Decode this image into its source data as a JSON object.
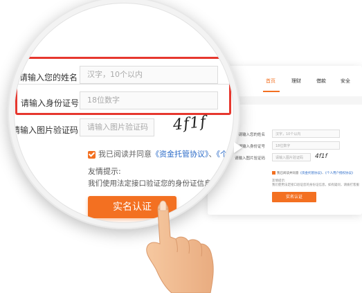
{
  "background_page": {
    "nav": [
      {
        "label": "首页",
        "active": true
      },
      {
        "label": "理财",
        "active": false
      },
      {
        "label": "借款",
        "active": false
      },
      {
        "label": "安全",
        "active": false
      }
    ],
    "form": {
      "name_label": "请输入您的姓名",
      "name_placeholder": "汉字，10个以内",
      "id_label": "请输入身份证号",
      "id_placeholder": "18位数字",
      "captcha_label": "请输入图片验证码",
      "captcha_placeholder": "请输入图片验证码",
      "captcha_text": "4f1f"
    },
    "agree_prefix": "我已阅读并同意",
    "agree_link1": "《资金托管协议》",
    "agree_mid": "、",
    "agree_link2": "《个人用户授权协议》",
    "tip_title": "友情提示:",
    "tip_text": "我们使用法定接口验证您的身份证信息，如有疑问，请拨打客服",
    "submit_label": "实名认证"
  },
  "magnifier": {
    "name_label": "请输入您的姓名",
    "name_placeholder": "汉字，10个以内",
    "id_label": "请输入身份证号",
    "id_placeholder": "18位数字",
    "captcha_label": "请输入图片验证码",
    "captcha_placeholder": "请输入图片验证码",
    "captcha_text": "4f1f",
    "agree_prefix": "我已阅读并同意",
    "agree_link1": "《资金托管协议》",
    "agree_mid": "、",
    "agree_link2": "《个人用户授权协",
    "tip_title": "友情提示:",
    "tip_text": "我们使用法定接口验证您的身份证信息，如有疑问",
    "submit_label": "实名认证"
  },
  "colors": {
    "accent": "#f37021",
    "highlight": "#e6372e",
    "link": "#2b6bc8"
  },
  "icons": [
    "checkbox-checked-icon",
    "pointing-hand-icon"
  ]
}
